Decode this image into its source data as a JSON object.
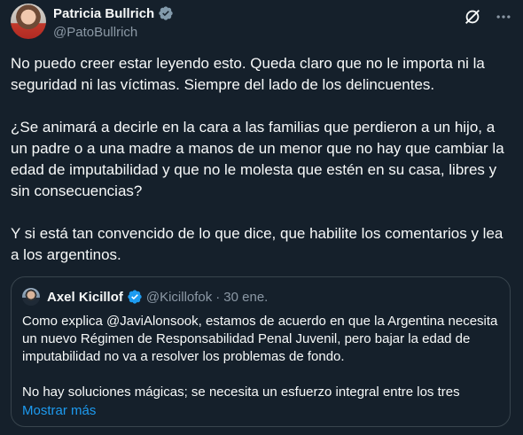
{
  "author": {
    "name": "Patricia Bullrich",
    "handle": "@PatoBullrich"
  },
  "tweet": {
    "paragraphs": [
      "No puedo creer estar leyendo esto. Queda claro que no le importa ni la seguridad ni las víctimas. Siempre del lado de los delincuentes.",
      "¿Se animará a decirle en la cara a las familias que perdieron a un hijo, a un padre o a una madre a manos de un menor que no hay que cambiar la edad de imputabilidad y que no le molesta que estén en su casa, libres y sin consecuencias?",
      "Y si está tan convencido de lo que dice, que habilite los comentarios y lea a los argentinos."
    ]
  },
  "quote": {
    "name": "Axel Kicillof",
    "handle": "@Kicillofok",
    "separator": "·",
    "date": "30 ene.",
    "paragraphs": [
      "Como explica @JaviAlonsook, estamos de acuerdo en que la Argentina necesita un nuevo Régimen de Responsabilidad Penal Juvenil, pero bajar la edad de imputabilidad no va a resolver los problemas de fondo.",
      "No hay soluciones mágicas; se necesita un esfuerzo integral entre los tres"
    ],
    "show_more": "Mostrar más"
  },
  "colors": {
    "background": "#15202b",
    "text": "#f7f9f9",
    "secondary": "#8b98a5",
    "accent": "#1d9bf0",
    "border": "#38444d"
  },
  "icons": [
    "verified-badge-icon",
    "grok-icon",
    "more-icon"
  ]
}
